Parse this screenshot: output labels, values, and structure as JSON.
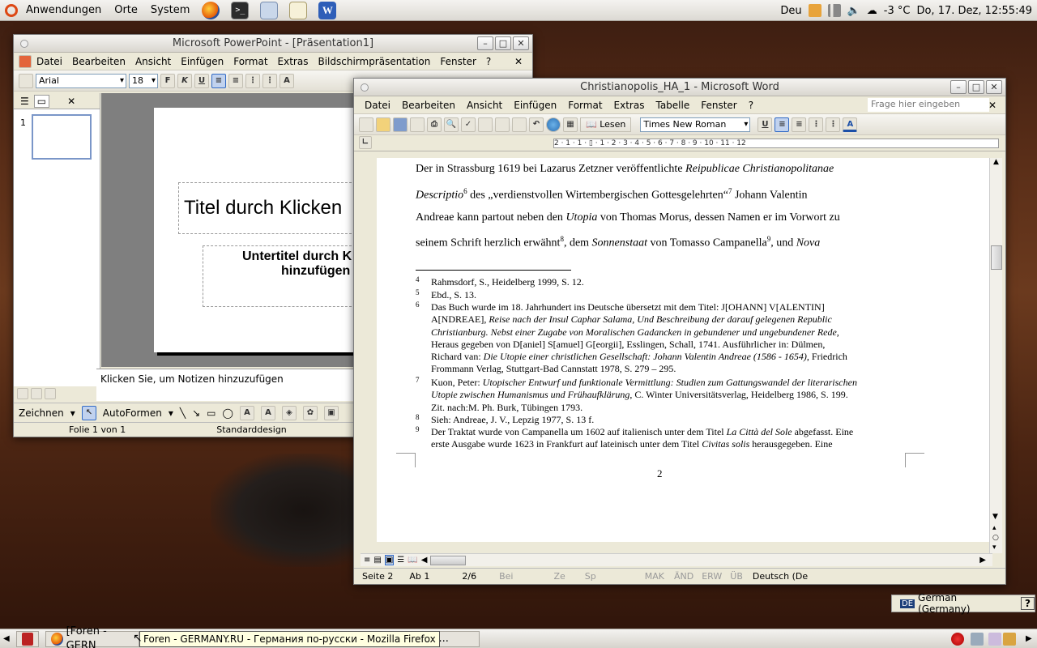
{
  "top_panel": {
    "menus": [
      "Anwendungen",
      "Orte",
      "System"
    ],
    "keyboard": "Deu",
    "weather": "-3 °C",
    "clock": "Do, 17. Dez, 12:55:49"
  },
  "powerpoint": {
    "title": "Microsoft PowerPoint - [Präsentation1]",
    "menu": [
      "Datei",
      "Bearbeiten",
      "Ansicht",
      "Einfügen",
      "Format",
      "Extras",
      "Bildschirmpräsentation",
      "Fenster",
      "?"
    ],
    "font": "Arial",
    "font_size": "18",
    "slide_number": "1",
    "title_placeholder": "Titel durch Klicken",
    "subtitle_placeholder_line1": "Untertitel durch K",
    "subtitle_placeholder_line2": "hinzufügen",
    "notes_placeholder": "Klicken Sie, um Notizen hinzuzufügen",
    "draw_label": "Zeichnen",
    "autoshapes_label": "AutoFormen",
    "status_slide": "Folie 1 von 1",
    "status_design": "Standarddesign"
  },
  "word": {
    "title": "Christianopolis_HA_1 - Microsoft Word",
    "menu": [
      "Datei",
      "Bearbeiten",
      "Ansicht",
      "Einfügen",
      "Format",
      "Extras",
      "Tabelle",
      "Fenster",
      "?"
    ],
    "ask_placeholder": "Frage hier eingeben",
    "read_button": "Lesen",
    "font": "Times New Roman",
    "ruler_text": "2 · 1 · 1 · ▯ · 1 · 2 · 3 · 4 · 5 · 6 · 7 · 8 · 9 · 10 · 11 · 12",
    "body": {
      "l1a": "Der in Strassburg 1619 bei Lazarus Zetzner veröffentlichte ",
      "l1b": "Reipublicae Christianopolitanae",
      "l2a": "Descriptio",
      "l2sup": "6",
      "l2b": " des „verdienstvollen Wirtembergischen Gottesgelehrten“",
      "l2sup2": "7",
      "l2c": " Johann Valentin",
      "l3a": "Andreae kann partout neben den ",
      "l3b": "Utopia",
      "l3c": " von Thomas Morus, dessen Namen er im Vorwort zu",
      "l4a": "seinem Schrift herzlich erwähnt",
      "l4sup": "8",
      "l4b": ", dem ",
      "l4c": "Sonnenstaat",
      "l4d": " von Tomasso Campanella",
      "l4sup2": "9",
      "l4e": ", und ",
      "l4f": "Nova"
    },
    "footnotes": {
      "f4n": "4",
      "f4": "Rahmsdorf, S., Heidelberg 1999, S. 12.",
      "f5n": "5",
      "f5": "Ebd., S. 13.",
      "f6n": "6",
      "f6a": "Das Buch wurde im 18. Jahrhundert ins Deutsche übersetzt mit dem Titel: J[OHANN] V[ALENTIN]",
      "f6b1": "A[NDREAE], ",
      "f6b2": "Reise nach der Insul Caphar Salama, Und Beschreibung der darauf gelegenen Republic",
      "f6c": "Christianburg. Nebst einer Zugabe von Moralischen Gadancken in gebundener und ungebundener Rede,",
      "f6d": "Heraus gegeben von D[aniel] S[amuel] G[eorgii], Esslingen, Schall, 1741. Ausführlicher in: Dülmen,",
      "f6e1": "Richard van: ",
      "f6e2": "Die Utopie einer christlichen Gesellschaft: Johann Valentin Andreae (1586 - 1654)",
      "f6e3": ", Friedrich",
      "f6f": "Frommann Verlag, Stuttgart-Bad Cannstatt 1978, S. 279 – 295.",
      "f7n": "7",
      "f7a1": "Kuon, Peter: ",
      "f7a2": "Utopischer Entwurf und funktionale Vermittlung: Studien zum Gattungswandel der literarischen",
      "f7b1": "Utopie zwischen Humanismus und Frühaufklärung",
      "f7b2": ", C. Winter Universitätsverlag, Heidelberg 1986, S. 199.",
      "f7c": "Zit. nach:M. Ph. Burk, Tübingen 1793.",
      "f8n": "8",
      "f8": "Sieh: Andreae, J. V., Lepzig 1977, S. 13 f.",
      "f9n": "9",
      "f9a1": "Der Traktat wurde von Campanella um 1602 auf italienisch unter dem Titel ",
      "f9a2": "La Città del Sole",
      "f9a3": " abgefasst. Eine",
      "f9b1": "erste Ausgabe wurde 1623 in Frankfurt auf lateinisch unter dem Titel ",
      "f9b2": "Civitas solis",
      "f9b3": " herausgegeben. Eine"
    },
    "page_number": "2",
    "status": {
      "page": "Seite 2",
      "section": "Ab 1",
      "pages": "2/6",
      "at": "Bei",
      "line": "Ze",
      "col": "Sp",
      "rec": "MAK",
      "trk": "ÄND",
      "ext": "ERW",
      "ovr": "ÜB",
      "lang": "Deutsch (De"
    }
  },
  "language_bar": {
    "flag": "DE",
    "label": "German (Germany)",
    "help": "?"
  },
  "taskbar": {
    "task1": "[Foren - GERN",
    "task2": "erPoint -...",
    "tooltip": "Foren - GERMANY.RU - Германия по-русски - Mozilla Firefox"
  },
  "colors": {
    "panel": "#dcd9d3",
    "window": "#ece9d8",
    "accent": "#dd4814"
  }
}
